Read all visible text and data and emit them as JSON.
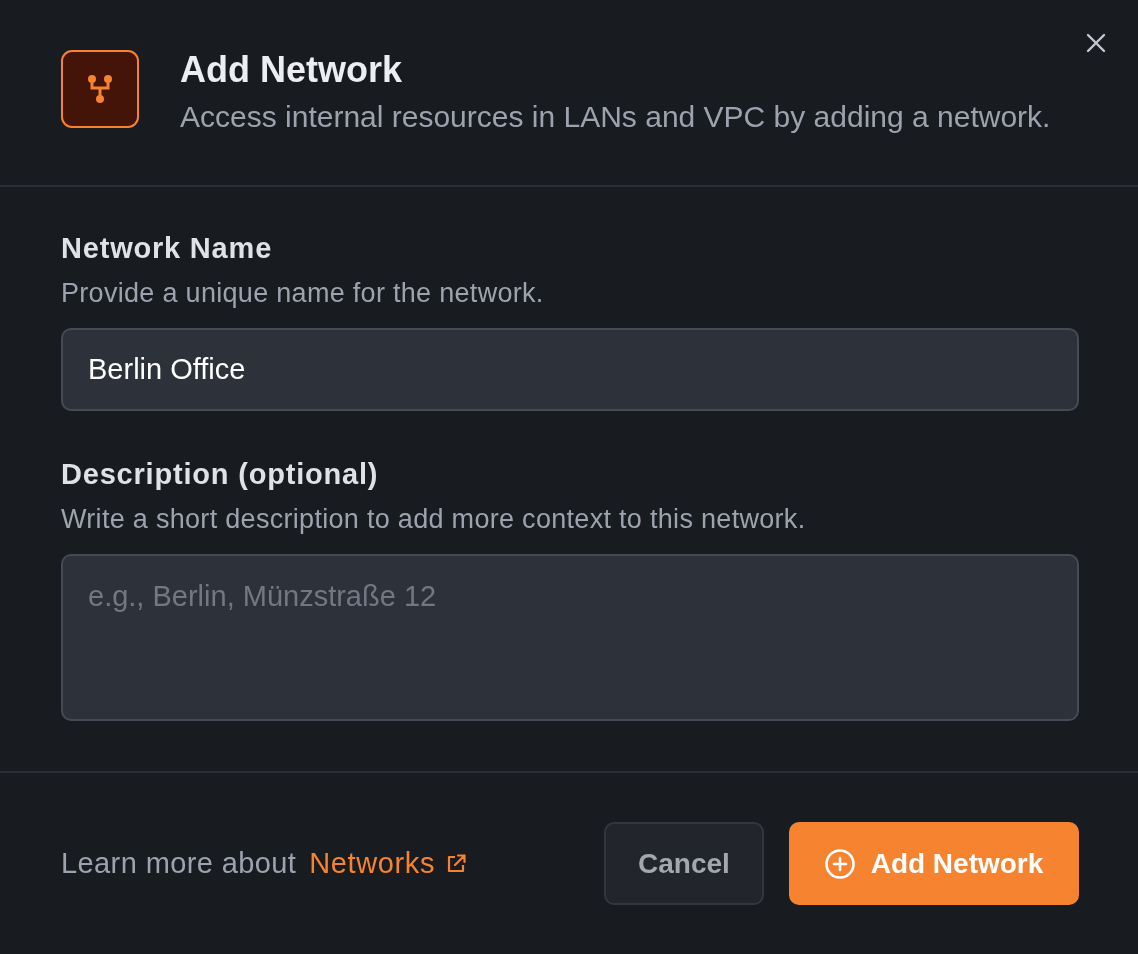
{
  "dialog": {
    "title": "Add Network",
    "subtitle": "Access internal resources in LANs and VPC by adding a network."
  },
  "fields": [
    {
      "kind": "input",
      "label": "Network Name",
      "help": "Provide a unique name for the network.",
      "value": "Berlin Office"
    },
    {
      "kind": "textarea",
      "label": "Description (optional)",
      "help": "Write a short description to add more context to this network.",
      "placeholder": "e.g., Berlin, Münzstraße 12"
    }
  ],
  "footer": {
    "learn_more": "Learn more about",
    "link": "Networks",
    "buttons": [
      {
        "kind": "secondary",
        "label": "Cancel"
      },
      {
        "kind": "primary",
        "label": "Add Network"
      }
    ]
  }
}
